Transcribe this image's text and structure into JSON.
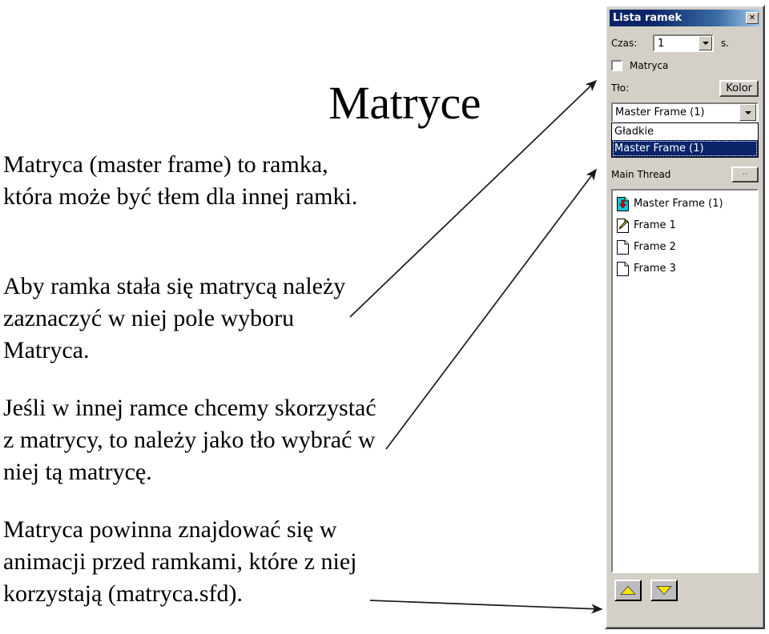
{
  "slide": {
    "title": "Matryce",
    "paragraphs": [
      "Matryca (master frame) to ramka, która może być tłem dla innej ramki.",
      "Aby ramka stała się matrycą należy zaznaczyć w niej pole wyboru Matryca.",
      "Jeśli w innej ramce chcemy skorzystać z matrycy, to należy jako tło wybrać w niej tą matrycę.",
      "Matryca powinna znajdować się w animacji przed ramkami, które z niej korzystają (matryca.sfd)."
    ]
  },
  "dialog": {
    "title": "Lista ramek",
    "close_label": "✕",
    "time": {
      "label": "Czas:",
      "value": "1",
      "unit": "s.",
      "dropdown_icon": "chevron-down-icon"
    },
    "master_checkbox": {
      "label": "Matryca",
      "checked": false
    },
    "background": {
      "label": "Tło:",
      "color_button": "Kolor",
      "selected": "Master Frame (1)",
      "options": [
        "Gładkie",
        "Master Frame (1)"
      ],
      "selected_index": 1
    },
    "thread": {
      "label": "Main Thread",
      "browse_label": ".."
    },
    "frames": [
      {
        "label": "Master Frame (1)",
        "icon": "master-frame-icon"
      },
      {
        "label": "Frame 1",
        "icon": "edited-frame-icon"
      },
      {
        "label": "Frame 2",
        "icon": "frame-icon"
      },
      {
        "label": "Frame 3",
        "icon": "frame-icon"
      }
    ],
    "move_buttons": [
      {
        "name": "move-up-button",
        "icon": "triangle-up-icon"
      },
      {
        "name": "move-down-button",
        "icon": "triangle-down-icon"
      }
    ],
    "colors": {
      "titlebar_start": "#0a246a",
      "titlebar_end": "#a6caf0",
      "face": "#d4d0c8",
      "selection": "#0a246a",
      "accent_yellow": "#ffe400",
      "master_icon_cyan": "#00c8d7",
      "master_icon_red": "#d00000"
    }
  }
}
